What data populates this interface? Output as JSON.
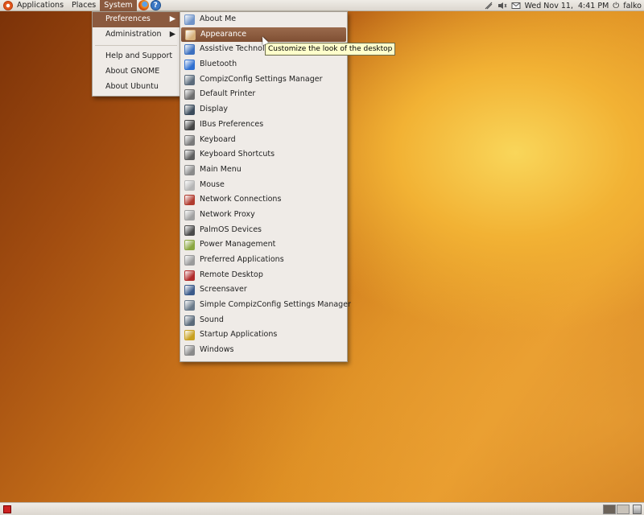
{
  "top_panel": {
    "menus": [
      "Applications",
      "Places",
      "System"
    ],
    "clock": "Wed Nov 11,  4:41 PM",
    "user": "falko",
    "launchers": [
      "firefox-icon",
      "help-icon"
    ],
    "tray_icons": [
      "network-icon",
      "volume-icon",
      "mail-icon"
    ]
  },
  "system_menu": {
    "items": [
      {
        "label": "Preferences",
        "submenu": true
      },
      {
        "label": "Administration",
        "submenu": true
      },
      {
        "label": "Help and Support"
      },
      {
        "label": "About GNOME"
      },
      {
        "label": "About Ubuntu"
      }
    ]
  },
  "preferences_menu": {
    "items": [
      {
        "label": "About Me",
        "icon": "about-me-icon",
        "color": "#6f93c8"
      },
      {
        "label": "Appearance",
        "icon": "appearance-icon",
        "color": "#d7b07a"
      },
      {
        "label": "Assistive Technologies",
        "icon": "accessibility-icon",
        "color": "#3b6fbf"
      },
      {
        "label": "Bluetooth",
        "icon": "bluetooth-icon",
        "color": "#2f6fd0"
      },
      {
        "label": "CompizConfig Settings Manager",
        "icon": "compizconfig-icon",
        "color": "#5a6a7a"
      },
      {
        "label": "Default Printer",
        "icon": "printer-icon",
        "color": "#6d6d6d"
      },
      {
        "label": "Display",
        "icon": "display-icon",
        "color": "#3b4b5b"
      },
      {
        "label": "IBus Preferences",
        "icon": "ibus-icon",
        "color": "#444444"
      },
      {
        "label": "Keyboard",
        "icon": "keyboard-icon",
        "color": "#7a7a7a"
      },
      {
        "label": "Keyboard Shortcuts",
        "icon": "keyboard-shortcuts-icon",
        "color": "#5e5e5e"
      },
      {
        "label": "Main Menu",
        "icon": "main-menu-icon",
        "color": "#8a8a8a"
      },
      {
        "label": "Mouse",
        "icon": "mouse-icon",
        "color": "#b5b5b5"
      },
      {
        "label": "Network Connections",
        "icon": "network-connections-icon",
        "color": "#b03a2e"
      },
      {
        "label": "Network Proxy",
        "icon": "network-proxy-icon",
        "color": "#a0a0a0"
      },
      {
        "label": "PalmOS Devices",
        "icon": "palm-icon",
        "color": "#4a4a4a"
      },
      {
        "label": "Power Management",
        "icon": "power-icon",
        "color": "#8aa640"
      },
      {
        "label": "Preferred Applications",
        "icon": "preferred-apps-icon",
        "color": "#9a9a9a"
      },
      {
        "label": "Remote Desktop",
        "icon": "remote-desktop-icon",
        "color": "#b02a2a"
      },
      {
        "label": "Screensaver",
        "icon": "screensaver-icon",
        "color": "#3a5a8a"
      },
      {
        "label": "Simple CompizConfig Settings Manager",
        "icon": "simple-ccsm-icon",
        "color": "#6a7a8a"
      },
      {
        "label": "Sound",
        "icon": "sound-icon",
        "color": "#5a6a7a"
      },
      {
        "label": "Startup Applications",
        "icon": "startup-icon",
        "color": "#c8a020"
      },
      {
        "label": "Windows",
        "icon": "windows-icon",
        "color": "#8a8a8a"
      }
    ],
    "highlighted_index": 1
  },
  "tooltip": "Customize the look of the desktop"
}
